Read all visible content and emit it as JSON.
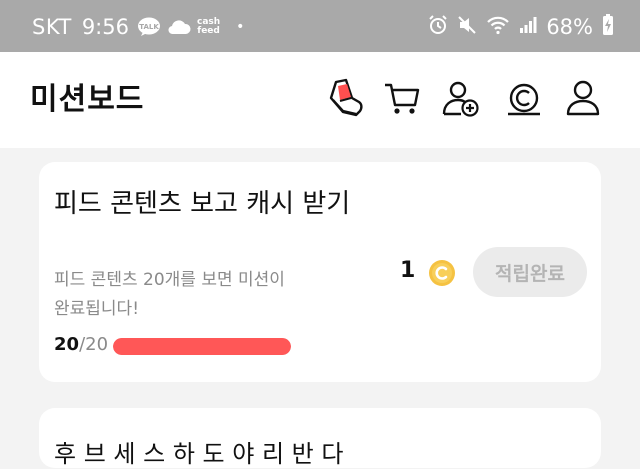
{
  "status_bar": {
    "carrier": "SKT",
    "time": "9:56",
    "talk_label": "TALK",
    "cashfeed_line1": "cash",
    "cashfeed_line2": "feed",
    "dot": "•",
    "battery": "68%"
  },
  "header": {
    "title": "미션보드",
    "icons": [
      "shoe-icon",
      "cart-icon",
      "add-friend-icon",
      "coin-icon",
      "profile-icon"
    ]
  },
  "missions": [
    {
      "title": "피드 콘텐츠 보고 캐시 받기",
      "description": "피드 콘텐츠 20개를 보면 미션이 완료됩니다!",
      "progress_current": "20",
      "progress_separator": "/",
      "progress_total": "20",
      "progress_fraction": 1.0,
      "reward_amount": "1",
      "button_label": "적립완료",
      "button_state": "completed"
    },
    {
      "title": "후 브 세 스 하 도 야 리 반 다"
    }
  ],
  "colors": {
    "status_bar_bg": "#a9a9a9",
    "background": "#f3f3f3",
    "progress_fill": "#ff5757",
    "coin_gold": "#f5c242",
    "disabled_button_bg": "#ebebeb",
    "disabled_button_text": "#b4b4b4",
    "shoe_red": "#ff4f4f"
  }
}
